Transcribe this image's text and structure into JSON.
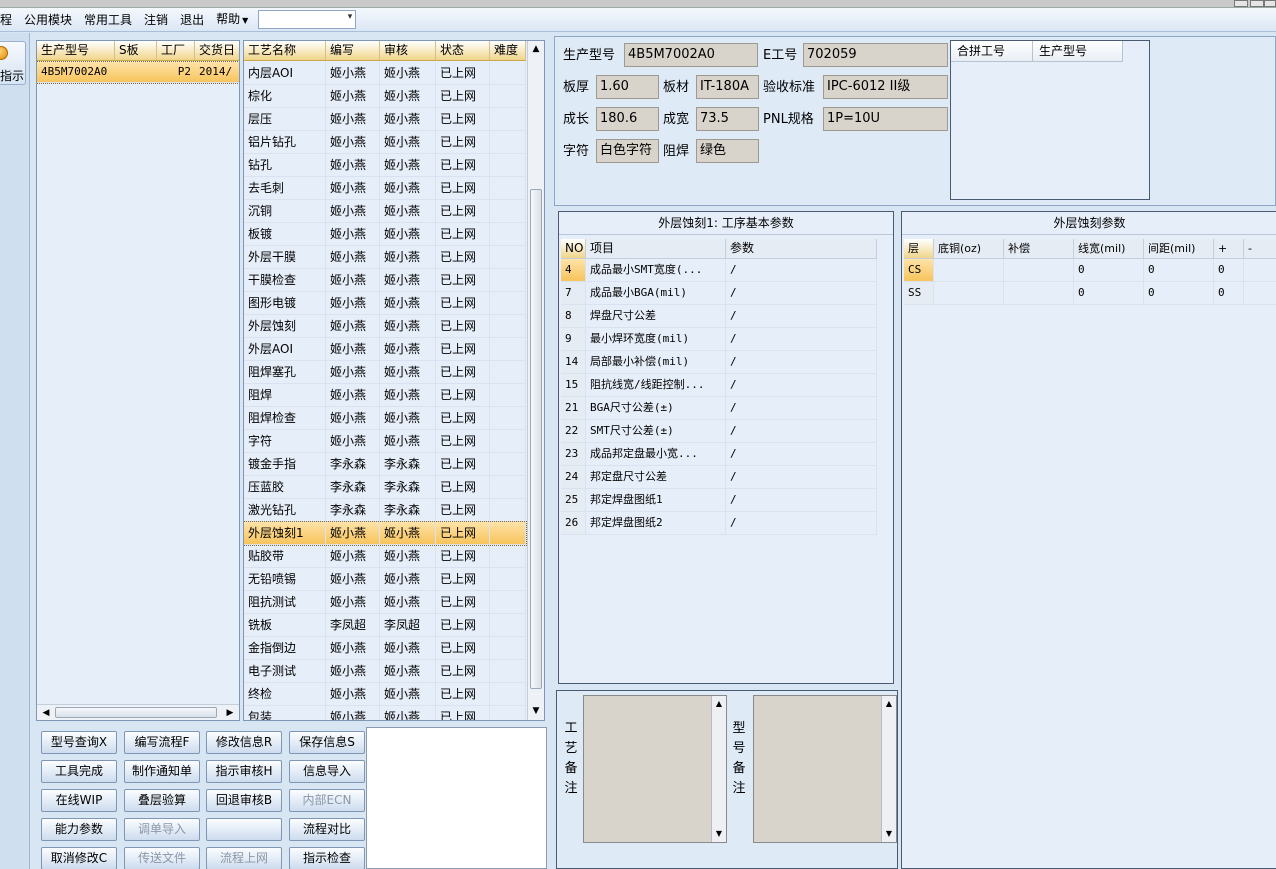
{
  "menu": {
    "items": [
      "程",
      "公用模块",
      "常用工具",
      "注销",
      "退出",
      "帮助"
    ],
    "combo_value": ""
  },
  "nav": {
    "label": "指示"
  },
  "models": {
    "columns": [
      "生产型号",
      "S板",
      "工厂",
      "交货日"
    ],
    "rows": [
      [
        "4B5M7002A0",
        "",
        "P2",
        "2014/"
      ]
    ]
  },
  "process": {
    "columns": [
      "工艺名称",
      "编写",
      "审核",
      "状态",
      "难度"
    ],
    "rows": [
      [
        "内层AOI",
        "姬小燕",
        "姬小燕",
        "已上网",
        ""
      ],
      [
        "棕化",
        "姬小燕",
        "姬小燕",
        "已上网",
        ""
      ],
      [
        "层压",
        "姬小燕",
        "姬小燕",
        "已上网",
        ""
      ],
      [
        "铝片钻孔",
        "姬小燕",
        "姬小燕",
        "已上网",
        ""
      ],
      [
        "钻孔",
        "姬小燕",
        "姬小燕",
        "已上网",
        ""
      ],
      [
        "去毛刺",
        "姬小燕",
        "姬小燕",
        "已上网",
        ""
      ],
      [
        "沉铜",
        "姬小燕",
        "姬小燕",
        "已上网",
        ""
      ],
      [
        "板镀",
        "姬小燕",
        "姬小燕",
        "已上网",
        ""
      ],
      [
        "外层干膜",
        "姬小燕",
        "姬小燕",
        "已上网",
        ""
      ],
      [
        "干膜检查",
        "姬小燕",
        "姬小燕",
        "已上网",
        ""
      ],
      [
        "图形电镀",
        "姬小燕",
        "姬小燕",
        "已上网",
        ""
      ],
      [
        "外层蚀刻",
        "姬小燕",
        "姬小燕",
        "已上网",
        ""
      ],
      [
        "外层AOI",
        "姬小燕",
        "姬小燕",
        "已上网",
        ""
      ],
      [
        "阻焊塞孔",
        "姬小燕",
        "姬小燕",
        "已上网",
        ""
      ],
      [
        "阻焊",
        "姬小燕",
        "姬小燕",
        "已上网",
        ""
      ],
      [
        "阻焊检查",
        "姬小燕",
        "姬小燕",
        "已上网",
        ""
      ],
      [
        "字符",
        "姬小燕",
        "姬小燕",
        "已上网",
        ""
      ],
      [
        "镀金手指",
        "李永森",
        "李永森",
        "已上网",
        ""
      ],
      [
        "压蓝胶",
        "李永森",
        "李永森",
        "已上网",
        ""
      ],
      [
        "激光钻孔",
        "李永森",
        "李永森",
        "已上网",
        ""
      ],
      [
        "外层蚀刻1",
        "姬小燕",
        "姬小燕",
        "已上网",
        ""
      ],
      [
        "贴胶带",
        "姬小燕",
        "姬小燕",
        "已上网",
        ""
      ],
      [
        "无铅喷锡",
        "姬小燕",
        "姬小燕",
        "已上网",
        ""
      ],
      [
        "阻抗测试",
        "姬小燕",
        "姬小燕",
        "已上网",
        ""
      ],
      [
        "铣板",
        "李凤超",
        "李凤超",
        "已上网",
        ""
      ],
      [
        "金指倒边",
        "姬小燕",
        "姬小燕",
        "已上网",
        ""
      ],
      [
        "电子测试",
        "姬小燕",
        "姬小燕",
        "已上网",
        ""
      ],
      [
        "终检",
        "姬小燕",
        "姬小燕",
        "已上网",
        ""
      ],
      [
        "包装",
        "姬小燕",
        "姬小燕",
        "已上网",
        ""
      ]
    ],
    "selected_index": 20
  },
  "buttons": [
    [
      "型号查询X",
      "编写流程F",
      "修改信息R",
      "保存信息S"
    ],
    [
      "工具完成",
      "制作通知单",
      "指示审核H",
      "信息导入"
    ],
    [
      "在线WIP",
      "叠层验算",
      "回退审核B",
      "内部ECN"
    ],
    [
      "能力参数",
      "调单导入",
      "",
      "流程对比"
    ],
    [
      "取消修改C",
      "传送文件",
      "流程上网",
      "指示检查"
    ]
  ],
  "disabled_buttons": [
    "内部ECN",
    "调单导入",
    "传送文件",
    "流程上网"
  ],
  "info": {
    "model_label": "生产型号",
    "model_value": "4B5M7002A0",
    "eng_label": "E工号",
    "eng_value": "702059",
    "thick_label": "板厚",
    "thick_value": "1.60",
    "material_label": "板材",
    "material_value": "IT-180A",
    "std_label": "验收标准",
    "std_value": "IPC-6012 II级",
    "len_label": "成长",
    "len_value": "180.6",
    "wid_label": "成宽",
    "wid_value": "73.5",
    "pnl_label": "PNL规格",
    "pnl_value": "1P=10U",
    "char_label": "字符",
    "char_value": "白色字符",
    "mask_label": "阻焊",
    "mask_value": "绿色",
    "merge_cols": [
      "合拼工号",
      "生产型号"
    ]
  },
  "params": {
    "title": "外层蚀刻1: 工序基本参数",
    "columns": [
      "NO",
      "项目",
      "参数"
    ],
    "rows": [
      [
        "4",
        "成品最小SMT宽度(...",
        "/"
      ],
      [
        "7",
        "成品最小BGA(mil)",
        "/"
      ],
      [
        "8",
        "焊盘尺寸公差",
        "/"
      ],
      [
        "9",
        "最小焊环宽度(mil)",
        "/"
      ],
      [
        "14",
        "局部最小补偿(mil)",
        "/"
      ],
      [
        "15",
        "阻抗线宽/线距控制...",
        "/"
      ],
      [
        "21",
        "BGA尺寸公差(±)",
        "/"
      ],
      [
        "22",
        "SMT尺寸公差(±)",
        "/"
      ],
      [
        "23",
        "成品邦定盘最小宽...",
        "/"
      ],
      [
        "24",
        "邦定盘尺寸公差",
        "/"
      ],
      [
        "25",
        "邦定焊盘图纸1",
        "/"
      ],
      [
        "26",
        "邦定焊盘图纸2",
        "/"
      ]
    ]
  },
  "etch": {
    "title": "外层蚀刻参数",
    "columns": [
      "层",
      "底铜(oz)",
      "补偿",
      "线宽(mil)",
      "间距(mil)",
      "+",
      "-"
    ],
    "rows": [
      [
        "CS",
        "",
        "",
        "0",
        "0",
        "0",
        ""
      ],
      [
        "SS",
        "",
        "",
        "0",
        "0",
        "0",
        ""
      ]
    ]
  },
  "remarks": {
    "process_label": "工艺备注",
    "model_label": "型号备注"
  },
  "colors": {
    "accent": "#f7c45c",
    "panel": "#e6eef9",
    "background": "#d8e6f4"
  }
}
